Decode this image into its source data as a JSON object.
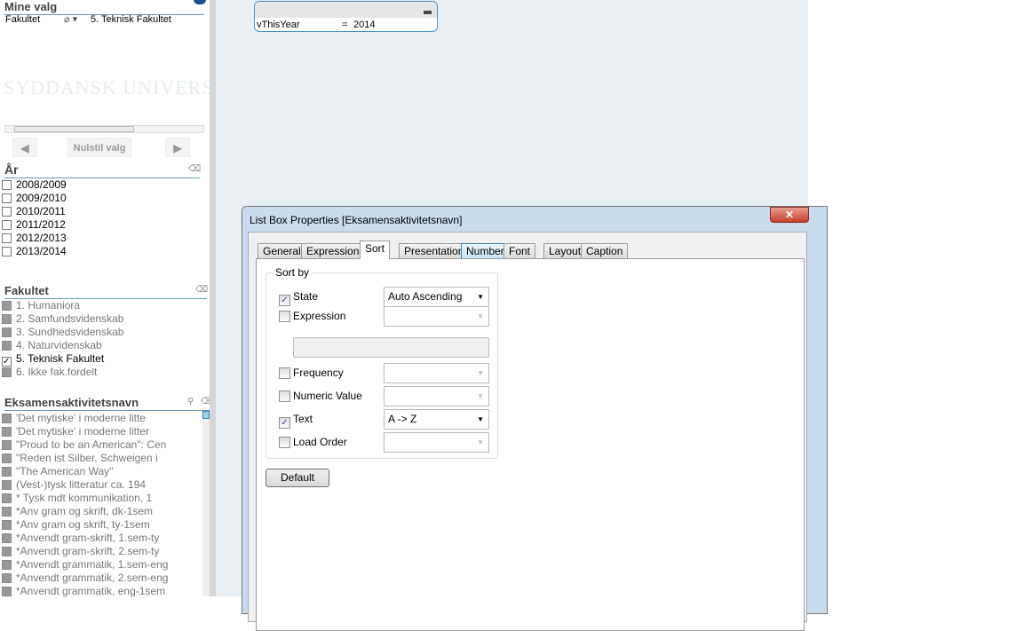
{
  "mine_valg": {
    "title": "Mine valg",
    "field": "Fakultet",
    "value": "5. Teknisk Fakultet",
    "watermark": "SYDDANSK UNIVERSITET",
    "reset_label": "Nulstil valg"
  },
  "aar": {
    "title": "År",
    "items": [
      "2008/2009",
      "2009/2010",
      "2010/2011",
      "2011/2012",
      "2012/2013",
      "2013/2014"
    ]
  },
  "fakultet": {
    "title": "Fakultet",
    "items": [
      {
        "label": "1. Humaniora",
        "selected": false
      },
      {
        "label": "2. Samfundsvidenskab",
        "selected": false
      },
      {
        "label": "3. Sundhedsvidenskab",
        "selected": false
      },
      {
        "label": "4. Naturvidenskab",
        "selected": false
      },
      {
        "label": "5. Teknisk Fakultet",
        "selected": true
      },
      {
        "label": "6. Ikke fak.fordelt",
        "selected": false
      }
    ]
  },
  "eksamen": {
    "title": "Eksamensaktivitetsnavn",
    "items": [
      "'Det mytiske' i moderne litte",
      "'Det mytiske' i moderne litter",
      "\"Proud to be an American\": Cen",
      "\"Reden ist Silber, Schweigen i",
      "\"The American Way\"",
      "(Vest-)tysk litteratur ca. 194",
      "* Tysk mdt kommunikation, 1",
      "*Anv gram og skrift, dk-1sem",
      "*Anv gram og skrift, ty-1sem",
      "*Anvendt gram-skrift, 1.sem-ty",
      "*Anvendt gram-skrift, 2.sem-ty",
      "*Anvendt grammatik, 1.sem-eng",
      "*Anvendt grammatik, 2.sem-eng",
      "*Anvendt grammatik, eng-1sem"
    ]
  },
  "variable": {
    "name": "vThisYear",
    "eq": "=",
    "value": "2014"
  },
  "dialog": {
    "title": "List Box Properties [Eksamensaktivitetsnavn]",
    "close": "✕",
    "tabs": [
      "General",
      "Expressions",
      "Sort",
      "Presentation",
      "Number",
      "Font",
      "Layout",
      "Caption"
    ],
    "active_tab": "Sort",
    "group_label": "Sort by",
    "sort": [
      {
        "label": "State",
        "checked": true,
        "value": "Auto Ascending"
      },
      {
        "label": "Expression",
        "checked": false,
        "value": ""
      },
      {
        "label": "Frequency",
        "checked": false,
        "value": ""
      },
      {
        "label": "Numeric Value",
        "checked": false,
        "value": ""
      },
      {
        "label": "Text",
        "checked": true,
        "value": "A -> Z"
      },
      {
        "label": "Load Order",
        "checked": false,
        "value": ""
      }
    ],
    "default_label": "Default"
  }
}
